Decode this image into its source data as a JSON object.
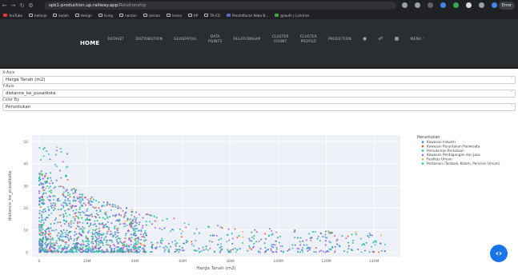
{
  "browser": {
    "url_host": "spk1-production.up.railway.app",
    "url_path": "/Relationship",
    "profile_label": "Error",
    "bookmarks": [
      "YouTube",
      "belanja",
      "kuliah",
      "design",
      "living",
      "nonton",
      "sarnan",
      "kreno",
      "KP",
      "TA-CO",
      "Pendaftaran Kebe B...",
      "@iaufn | Linktree"
    ]
  },
  "navbar": {
    "home": "HOME",
    "items": [
      {
        "line1": "DATASET",
        "line2": ""
      },
      {
        "line1": "DISTRIBUTION",
        "line2": ""
      },
      {
        "line1": "GEOSPATIAL",
        "line2": ""
      },
      {
        "line1": "DATA",
        "line2": "POINTS"
      },
      {
        "line1": "RELATIONSHIP",
        "line2": ""
      },
      {
        "line1": "CLUSTER",
        "line2": "COUNT"
      },
      {
        "line1": "CLUSTER",
        "line2": "PROFILE"
      },
      {
        "line1": "PREDICTION",
        "line2": ""
      }
    ],
    "menu_label": "MENU"
  },
  "controls": {
    "xaxis_label": "X-Axis",
    "xaxis_value": "Harga Tanah (m2)",
    "yaxis_label": "Y-Axis",
    "yaxis_value": "distance_ke_pusatkota",
    "color_label": "Color By",
    "color_value": "Peruntukan"
  },
  "chart_data": {
    "type": "scatter",
    "xlabel": "Harga Tanah (m2)",
    "ylabel": "distance_ke_pusatkota",
    "xlim": [
      -3000000,
      151000000
    ],
    "ylim": [
      -2,
      53
    ],
    "x_ticks": [
      "0",
      "20M",
      "40M",
      "60M",
      "80M",
      "100M",
      "120M",
      "140M"
    ],
    "x_tick_values": [
      0,
      20000000,
      40000000,
      60000000,
      80000000,
      100000000,
      120000000,
      140000000
    ],
    "y_ticks": [
      "0",
      "10",
      "20",
      "30",
      "40",
      "50"
    ],
    "y_tick_values": [
      0,
      10,
      20,
      30,
      40,
      50
    ],
    "legend_title": "Peruntukan",
    "series": [
      {
        "name": "Kawasan Industri",
        "color": "#5b6fd6"
      },
      {
        "name": "Kawasan Peruntukan Pariwisata",
        "color": "#e8562f"
      },
      {
        "name": "Pemukiman Perkotaan",
        "color": "#1fb784"
      },
      {
        "name": "Kawasan Perdagangan dan Jasa",
        "color": "#a463e8"
      },
      {
        "name": "Fasilitas Umum",
        "color": "#f3a35c"
      },
      {
        "name": "Pertanian (Tambak, Kolam, Perairan Umum)",
        "color": "#2cc0d0"
      }
    ]
  }
}
